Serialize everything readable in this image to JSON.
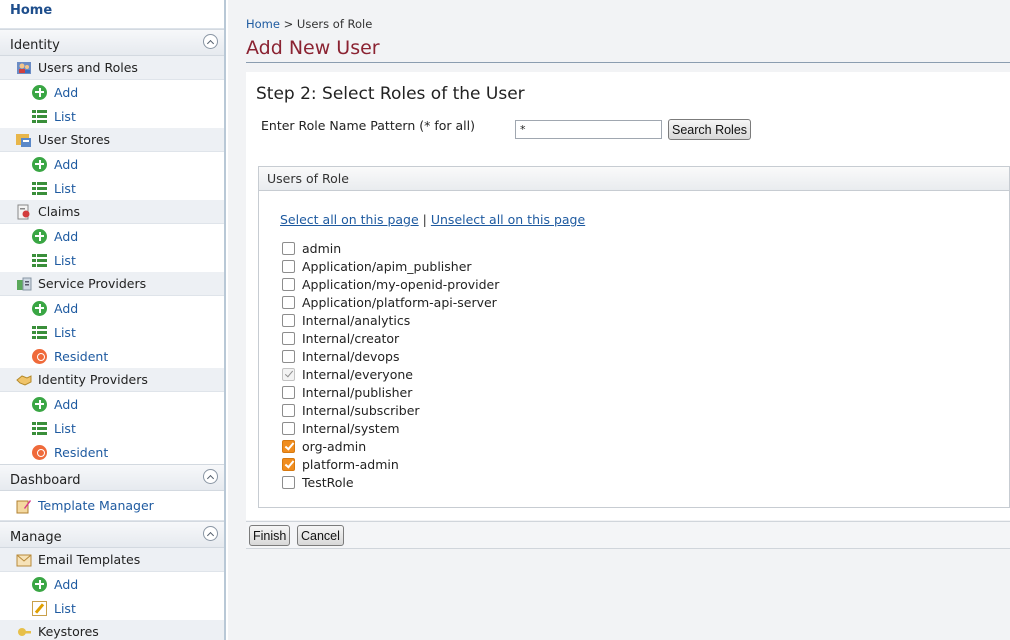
{
  "sidebar": {
    "home": "Home",
    "sections": [
      {
        "title": "Identity",
        "groups": [
          {
            "label": "Users and Roles",
            "items": [
              {
                "label": "Add",
                "icon": "add-icon"
              },
              {
                "label": "List",
                "icon": "list-icon"
              }
            ]
          },
          {
            "label": "User Stores",
            "items": [
              {
                "label": "Add",
                "icon": "add-icon"
              },
              {
                "label": "List",
                "icon": "list-icon"
              }
            ]
          },
          {
            "label": "Claims",
            "items": [
              {
                "label": "Add",
                "icon": "add-icon"
              },
              {
                "label": "List",
                "icon": "list-icon"
              }
            ]
          },
          {
            "label": "Service Providers",
            "items": [
              {
                "label": "Add",
                "icon": "add-icon"
              },
              {
                "label": "List",
                "icon": "list-icon"
              },
              {
                "label": "Resident",
                "icon": "resident-icon"
              }
            ]
          },
          {
            "label": "Identity Providers",
            "items": [
              {
                "label": "Add",
                "icon": "add-icon"
              },
              {
                "label": "List",
                "icon": "list-icon"
              },
              {
                "label": "Resident",
                "icon": "resident-icon"
              }
            ]
          }
        ]
      },
      {
        "title": "Dashboard",
        "groups": [
          {
            "label": "Template Manager",
            "link": true,
            "items": []
          }
        ]
      },
      {
        "title": "Manage",
        "groups": [
          {
            "label": "Email Templates",
            "items": [
              {
                "label": "Add",
                "icon": "add-icon"
              },
              {
                "label": "List",
                "icon": "edit-icon"
              }
            ]
          },
          {
            "label": "Keystores",
            "items": []
          }
        ]
      }
    ]
  },
  "breadcrumb": {
    "home": "Home",
    "separator": ">",
    "current": "Users of Role"
  },
  "page_title": "Add New User",
  "step_title": "Step 2: Select Roles of the User",
  "search": {
    "label": "Enter Role Name Pattern (* for all)",
    "value": "*",
    "button": "Search Roles"
  },
  "roles_panel": {
    "header": "Users of Role",
    "select_all": "Select all on this page",
    "link_separator": "|",
    "unselect_all": "Unselect all on this page",
    "roles": [
      {
        "name": "admin",
        "state": "unchecked"
      },
      {
        "name": "Application/apim_publisher",
        "state": "unchecked"
      },
      {
        "name": "Application/my-openid-provider",
        "state": "unchecked"
      },
      {
        "name": "Application/platform-api-server",
        "state": "unchecked"
      },
      {
        "name": "Internal/analytics",
        "state": "unchecked"
      },
      {
        "name": "Internal/creator",
        "state": "unchecked"
      },
      {
        "name": "Internal/devops",
        "state": "unchecked"
      },
      {
        "name": "Internal/everyone",
        "state": "disabled-checked"
      },
      {
        "name": "Internal/publisher",
        "state": "unchecked"
      },
      {
        "name": "Internal/subscriber",
        "state": "unchecked"
      },
      {
        "name": "Internal/system",
        "state": "unchecked"
      },
      {
        "name": "org-admin",
        "state": "checked"
      },
      {
        "name": "platform-admin",
        "state": "checked"
      },
      {
        "name": "TestRole",
        "state": "unchecked"
      }
    ]
  },
  "actions": {
    "finish": "Finish",
    "cancel": "Cancel"
  },
  "colors": {
    "title": "#8b2332",
    "link": "#1e5aa0",
    "checkbox_checked": "#f08d1e"
  }
}
